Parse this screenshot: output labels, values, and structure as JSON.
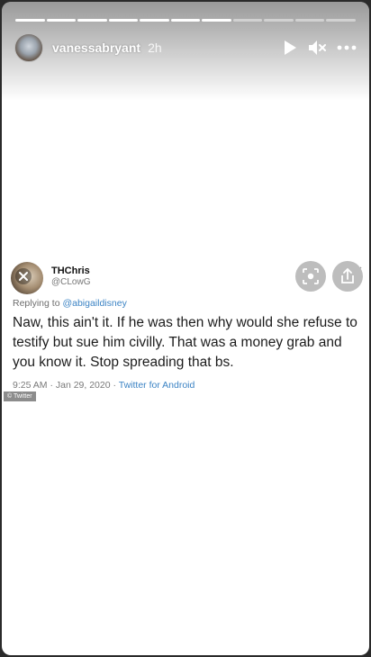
{
  "story": {
    "segments_total": 11,
    "segments_completed": 7,
    "username": "vanessabryant",
    "time_ago": "2h"
  },
  "tweet": {
    "display_name": "THChris",
    "handle": "@CLowG",
    "replying_prefix": "Replying to",
    "replying_to": "@abigaildisney",
    "text": "Naw, this ain't it. If he was then why would she refuse to testify but sue him civilly. That was a money grab and you know it. Stop spreading that bs.",
    "timestamp": "9:25 AM · Jan 29, 2020 ·",
    "client": "Twitter for Android",
    "source_credit": "© Twitter"
  },
  "icons": {
    "play": "play-icon",
    "mute": "speaker-muted-icon",
    "more": "more-horizontal-icon",
    "lens": "visual-search-icon",
    "share": "share-icon"
  },
  "colors": {
    "link": "#3b83c4",
    "background": "#ffffff"
  }
}
